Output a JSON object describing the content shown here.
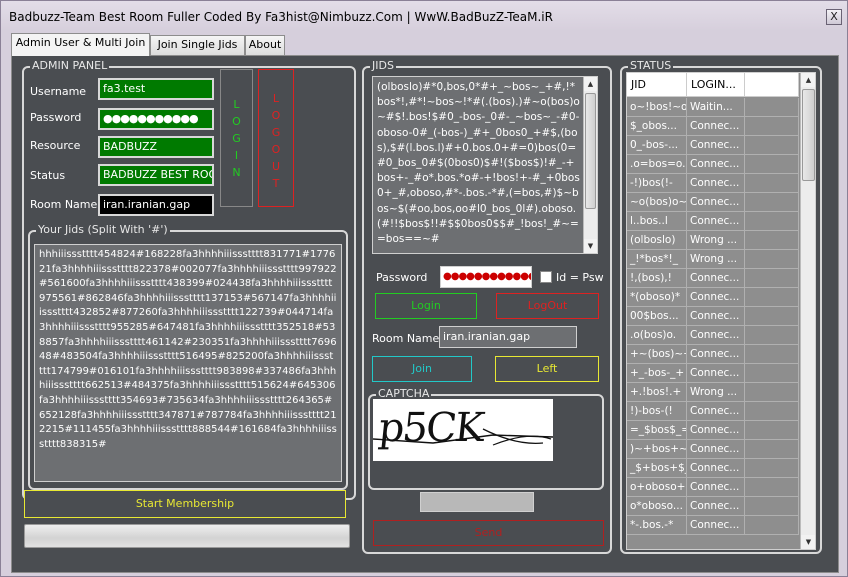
{
  "window": {
    "title": "Badbuzz-Team Best Room Fuller Coded By Fa3hist@Nimbuzz.Com | WwW.BadBuzZ-TeaM.iR",
    "close_label": "X"
  },
  "tabs": [
    {
      "label": "Admin User & Multi Join"
    },
    {
      "label": "Join Single Jids"
    },
    {
      "label": "About"
    }
  ],
  "admin_panel": {
    "title": "ADMIN PANEL",
    "username_label": "Username",
    "username_value": "fa3.test",
    "password_label": "Password",
    "password_value": "●●●●●●●●●●●",
    "resource_label": "Resource",
    "resource_value": "BADBUZZ",
    "status_label": "Status",
    "status_value": "BADBUZZ BEST ROOM",
    "room_label": "Room Name",
    "room_value": "iran.iranian.gap",
    "login_letters": [
      "L",
      "O",
      "G",
      "I",
      "N"
    ],
    "logout_letters": [
      "L",
      "O",
      "G",
      "O",
      "U",
      "T"
    ]
  },
  "your_jids": {
    "title": "Your Jids (Split With '#')",
    "text": "hhhiiissstttt454824#168228fa3hhhhiiissstttt831771#177621fa3hhhhiiissstttt822378#002077fa3hhhhiiissstttt997922#561600fa3hhhhiiissstttt438399#024438fa3hhhhiiissstttt975561#862846fa3hhhhiiissstttt137153#567147fa3hhhhiiissstttt432852#877260fa3hhhhiiissstttt122739#044714fa3hhhhiiissstttt955285#647481fa3hhhhiiissstttt352518#538857fa3hhhhiiissstttt461142#230351fa3hhhhiiissstttt769648#483504fa3hhhhiiissstttt516495#825200fa3hhhhiiissstttt174799#016101fa3hhhhiiissstttt983898#337486fa3hhhhiiissstttt662513#484375fa3hhhhiiissstttt515624#645306fa3hhhhiiissstttt354693#735634fa3hhhhiiissstttt264365#652128fa3hhhhiiissstttt347871#787784fa3hhhhiiissstttt212215#111455fa3hhhhiiissstttt888544#161684fa3hhhhiiissstttt838315#"
  },
  "start_membership_label": "Start Membership",
  "bottom_progress": 0,
  "jids": {
    "title": "JIDS",
    "text": "(olboslo)#*0,bos,0*#+_~bos~_+#,!*bos*!,#*!~bos~!*#(.(bos).)#~o(bos)o~#$!.bos!$#0_-bos-_0#-_~bos~_-#0-oboso-0#_(-bos-)_#+_0bos0_+#$,(bos),$#(l.bos.l)#+0.bos.0+#=0)bos(0=#0_bos_0#$(0bos0)$#!($bos$)!#_-+bos+-_#o*.bos.*o#-+!bos!+-#_+0bos0+_#,oboso,#*-.bos.-*#,(=bos,#)$~bos~$(#oo,bos,oo#l0_bos_0l#).oboso.(#!!$bos$!!#$$0bos0$$#_!bos!_#~==bos==~#",
    "password_label": "Password",
    "password_value": "●●●●●●●●●●●●",
    "id_psw_label": "Id = Psw",
    "login_label": "Login",
    "logout_label": "LogOut",
    "room_label": "Room Name",
    "room_value": "iran.iranian.gap",
    "join_label": "Join",
    "left_label": "Left",
    "captcha_title": "CAPTCHA",
    "captcha_text": "p5CK",
    "send_label": "Send"
  },
  "status": {
    "title": "STATUS",
    "columns": [
      "JID",
      "LOGIN..."
    ],
    "rows": [
      [
        "o~!bos!~o",
        "Waitin..."
      ],
      [
        "$_obos...",
        "Connec..."
      ],
      [
        "0_-bos-...",
        "Connec..."
      ],
      [
        ".o=bos=o.",
        "Connec..."
      ],
      [
        "-!)bos(!-",
        "Connec..."
      ],
      [
        "~o(bos)o~",
        "Connec..."
      ],
      [
        "l..bos..l",
        "Connec..."
      ],
      [
        "(olboslo)",
        "Wrong ..."
      ],
      [
        "_!*bos*!_",
        "Wrong ..."
      ],
      [
        "!,(bos),!",
        "Connec..."
      ],
      [
        "*(oboso)*",
        "Connec..."
      ],
      [
        "00$bos...",
        "Connec..."
      ],
      [
        ".o(bos)o.",
        "Connec..."
      ],
      [
        "+~(bos)~+",
        "Connec..."
      ],
      [
        "+_-bos-_+",
        "Connec..."
      ],
      [
        "+.!bos!.+",
        "Wrong ..."
      ],
      [
        "!)-bos-(!",
        "Connec..."
      ],
      [
        "=_$bos$_=",
        "Connec..."
      ],
      [
        ")~+bos+~(",
        "Connec..."
      ],
      [
        "_$+bos+$_",
        "Connec..."
      ],
      [
        "o+oboso+o",
        "Connec..."
      ],
      [
        "o*oboso...",
        "Connec..."
      ],
      [
        "*-.bos.-*",
        "Connec..."
      ]
    ]
  },
  "colors": {
    "panel_bg": "#4a4d51",
    "field_green": "#007a00",
    "accent_green": "#22cc22",
    "accent_red": "#dd2222",
    "accent_yellow": "#e8e833",
    "accent_cyan": "#22c8c8"
  }
}
